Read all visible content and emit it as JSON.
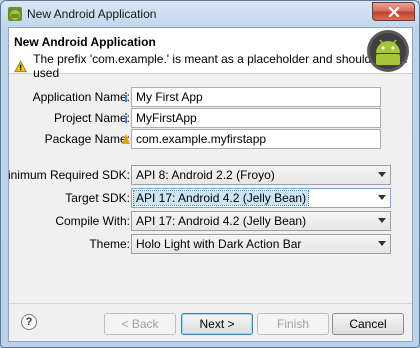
{
  "window": {
    "title": "New Android Application"
  },
  "banner": {
    "title": "New Android Application",
    "warning": "The prefix 'com.example.' is meant as a placeholder and should not be used"
  },
  "fields": {
    "application_name": {
      "label": "Application Name:",
      "value": "My First App"
    },
    "project_name": {
      "label": "Project Name:",
      "value": "MyFirstApp"
    },
    "package_name": {
      "label": "Package Name:",
      "value": "com.example.myfirstapp"
    }
  },
  "selects": {
    "min_sdk": {
      "label": "Minimum Required SDK:",
      "value": "API 8: Android 2.2 (Froyo)"
    },
    "target_sdk": {
      "label": "Target SDK:",
      "value": "API 17: Android 4.2 (Jelly Bean)"
    },
    "compile_with": {
      "label": "Compile With:",
      "value": "API 17: Android 4.2 (Jelly Bean)"
    },
    "theme": {
      "label": "Theme:",
      "value": "Holo Light with Dark Action Bar"
    }
  },
  "buttons": {
    "help": "?",
    "back": "< Back",
    "next": "Next >",
    "finish": "Finish",
    "cancel": "Cancel"
  },
  "colors": {
    "accent": "#3c7fb1",
    "title_gradient": "#bcd2ea",
    "close": "#c24030"
  }
}
